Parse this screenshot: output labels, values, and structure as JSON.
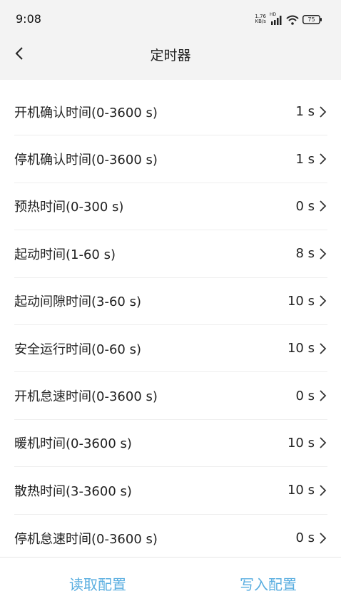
{
  "status_bar": {
    "time": "9:08",
    "net_speed_value": "1.76",
    "net_speed_unit": "KB/s",
    "hd_label": "HD",
    "battery": "75"
  },
  "header": {
    "title": "定时器"
  },
  "settings": [
    {
      "label": "开机确认时间(0-3600 s)",
      "value": "1 s"
    },
    {
      "label": "停机确认时间(0-3600 s)",
      "value": "1 s"
    },
    {
      "label": "预热时间(0-300 s)",
      "value": "0 s"
    },
    {
      "label": "起动时间(1-60 s)",
      "value": "8 s"
    },
    {
      "label": "起动间隙时间(3-60 s)",
      "value": "10 s"
    },
    {
      "label": "安全运行时间(0-60 s)",
      "value": "10 s"
    },
    {
      "label": "开机怠速时间(0-3600 s)",
      "value": "0 s"
    },
    {
      "label": "暖机时间(0-3600 s)",
      "value": "10 s"
    },
    {
      "label": "散热时间(3-3600 s)",
      "value": "10 s"
    },
    {
      "label": "停机怠速时间(0-3600 s)",
      "value": "0 s"
    }
  ],
  "footer": {
    "read_label": "读取配置",
    "write_label": "写入配置"
  },
  "colors": {
    "accent": "#5aaee0",
    "header_bg": "#f3f3f3",
    "divider": "#eeeeee"
  },
  "icons": {
    "back": "chevron-left-icon",
    "row": "chevron-right-icon",
    "signal": "signal-icon",
    "wifi": "wifi-icon",
    "battery": "battery-icon"
  }
}
